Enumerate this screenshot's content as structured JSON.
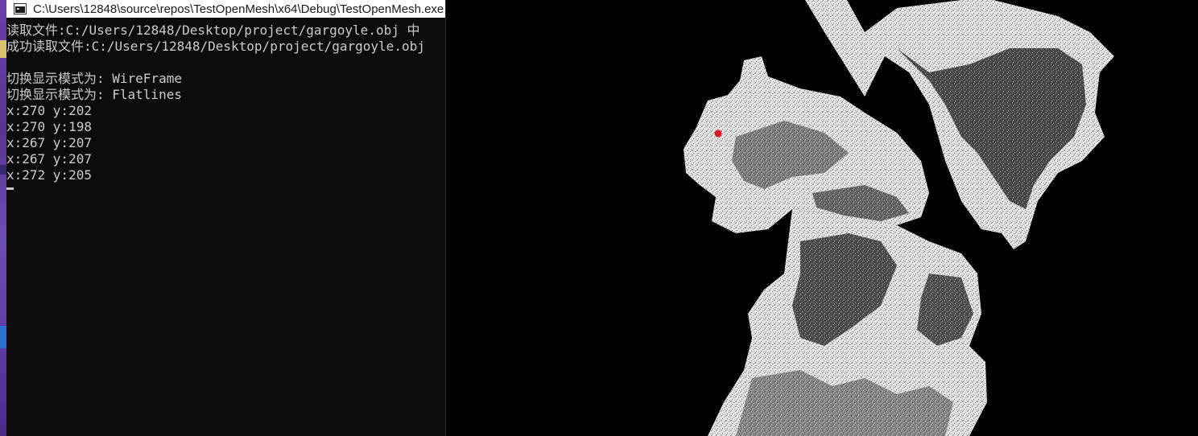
{
  "console": {
    "title": "C:\\Users\\12848\\source\\repos\\TestOpenMesh\\x64\\Debug\\TestOpenMesh.exe",
    "lines": [
      "读取文件:C:/Users/12848/Desktop/project/gargoyle.obj 中",
      "成功读取文件:C:/Users/12848/Desktop/project/gargoyle.obj",
      "",
      "切换显示模式为: WireFrame",
      "切换显示模式为: Flatlines",
      "x:270 y:202",
      "x:270 y:198",
      "x:267 y:207",
      "x:267 y:207",
      "x:272 y:205"
    ]
  },
  "viewport": {
    "model_icon": "gargoyle-mesh",
    "background_color": "#000000",
    "light_color": "#e8e8e8",
    "shadow_color": "#3c3c3c",
    "marker_color": "#e0141e"
  }
}
